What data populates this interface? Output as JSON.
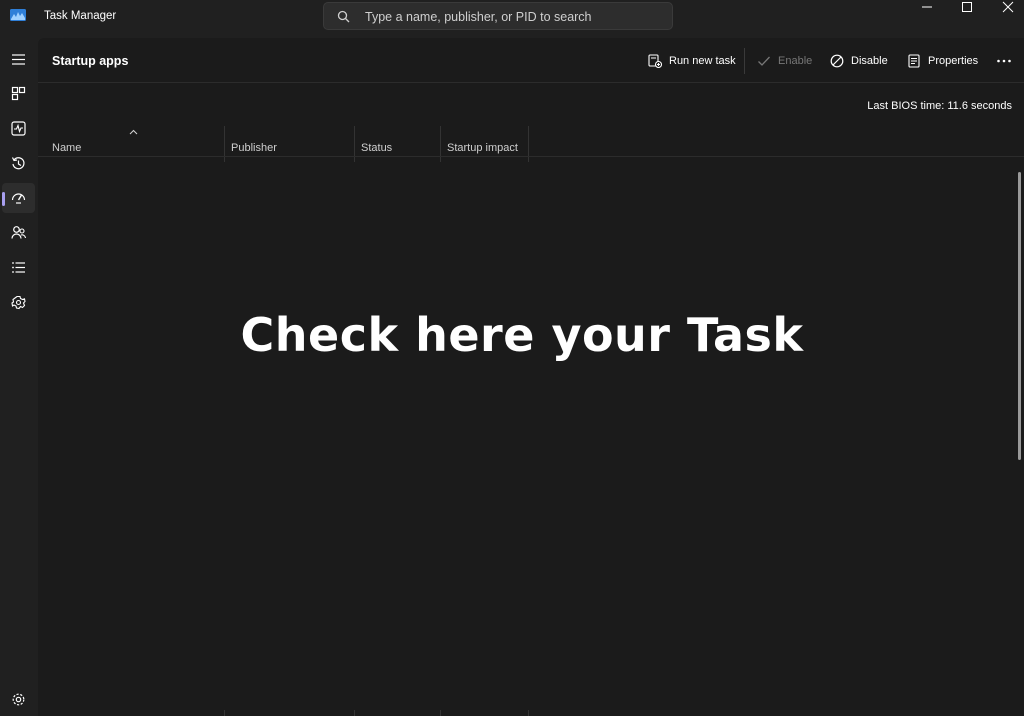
{
  "window": {
    "title": "Task Manager",
    "search_placeholder": "Type a name, publisher, or PID to search"
  },
  "nav": {
    "items": [
      {
        "name": "menu",
        "icon": "hamburger-icon"
      },
      {
        "name": "processes",
        "icon": "processes-icon"
      },
      {
        "name": "performance",
        "icon": "performance-icon"
      },
      {
        "name": "app-history",
        "icon": "history-icon"
      },
      {
        "name": "startup-apps",
        "icon": "startup-icon",
        "active": true
      },
      {
        "name": "users",
        "icon": "users-icon"
      },
      {
        "name": "details",
        "icon": "details-icon"
      },
      {
        "name": "services",
        "icon": "services-icon"
      },
      {
        "name": "settings",
        "icon": "settings-icon"
      }
    ]
  },
  "header": {
    "title": "Startup apps"
  },
  "toolbar": {
    "run_new_task": "Run new task",
    "enable": "Enable",
    "disable": "Disable",
    "properties": "Properties"
  },
  "bios": {
    "label": "Last BIOS time:  11.6 seconds"
  },
  "table": {
    "columns": [
      "Name",
      "Publisher",
      "Status",
      "Startup impact"
    ]
  },
  "overlay": {
    "text": "Check here your Task"
  },
  "colors": {
    "accent": "#a89ff0",
    "background": "#1b1b1b",
    "chrome": "#202020"
  }
}
